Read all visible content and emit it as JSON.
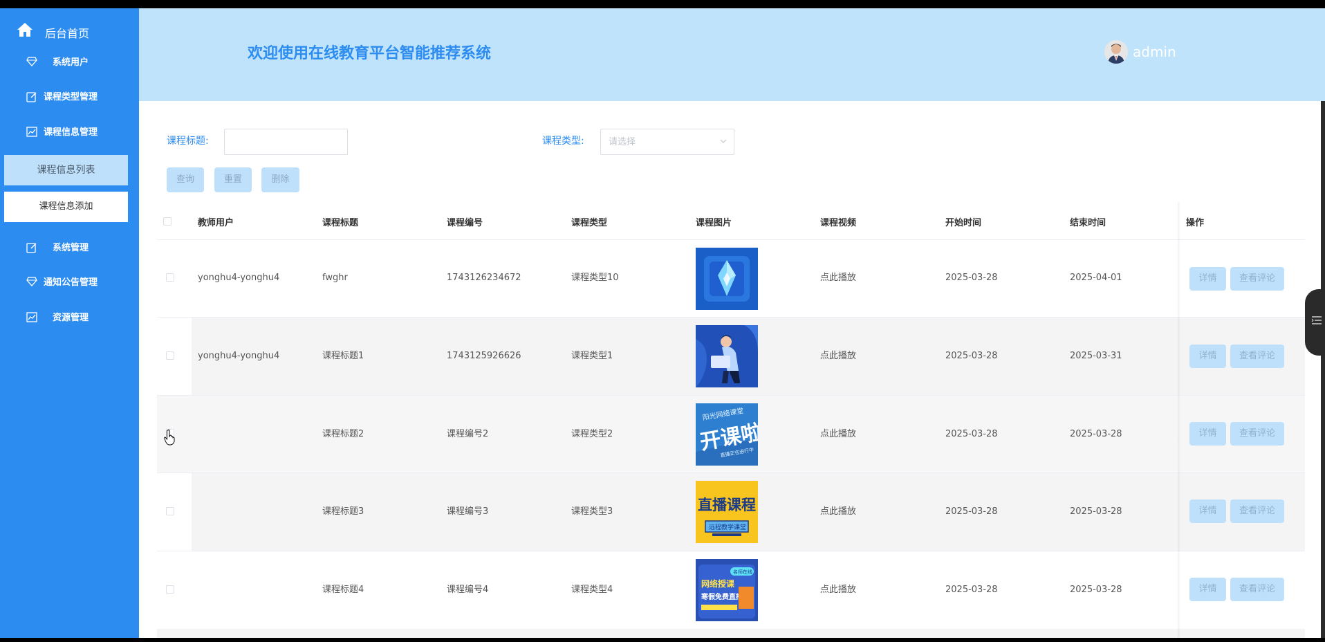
{
  "sidebar": {
    "home": "后台首页",
    "items": [
      {
        "label": "系统用户"
      },
      {
        "label": "课程类型管理"
      },
      {
        "label": "课程信息管理"
      },
      {
        "label": "系统管理"
      },
      {
        "label": "通知公告管理"
      },
      {
        "label": "资源管理"
      }
    ],
    "sub_items": [
      {
        "label": "课程信息列表",
        "active": true
      },
      {
        "label": "课程信息添加",
        "active": false
      }
    ]
  },
  "header": {
    "welcome": "欢迎使用在线教育平台智能推荐系统",
    "username": "admin"
  },
  "search": {
    "title_label": "课程标题:",
    "title_value": "",
    "type_label": "课程类型:",
    "type_placeholder": "请选择"
  },
  "actions": {
    "query": "查询",
    "reset": "重置",
    "delete": "删除"
  },
  "table": {
    "columns": [
      "教师用户",
      "课程标题",
      "课程编号",
      "课程类型",
      "课程图片",
      "课程视频",
      "开始时间",
      "结束时间",
      "操作"
    ],
    "rows": [
      {
        "teacher": "yonghu4-yonghu4",
        "title": "fwghr",
        "code": "1743126234672",
        "type": "课程类型10",
        "image": "blue-crystal",
        "video": "点此播放",
        "start": "2025-03-28",
        "end": "2025-04-01"
      },
      {
        "teacher": "yonghu4-yonghu4",
        "title": "课程标题1",
        "code": "1743125926626",
        "type": "课程类型1",
        "image": "person-laptop",
        "video": "点此播放",
        "start": "2025-03-28",
        "end": "2025-03-31"
      },
      {
        "teacher": "",
        "title": "课程标题2",
        "code": "课程编号2",
        "type": "课程类型2",
        "image": "kaikela-poster",
        "video": "点此播放",
        "start": "2025-03-28",
        "end": "2025-03-28"
      },
      {
        "teacher": "",
        "title": "课程标题3",
        "code": "课程编号3",
        "type": "课程类型3",
        "image": "zhibo-poster",
        "video": "点此播放",
        "start": "2025-03-28",
        "end": "2025-03-28"
      },
      {
        "teacher": "",
        "title": "课程标题4",
        "code": "课程编号4",
        "type": "课程类型4",
        "image": "online-class-poster",
        "video": "点此播放",
        "start": "2025-03-28",
        "end": "2025-03-28"
      }
    ],
    "row_actions": {
      "detail": "详情",
      "comments": "查看评论"
    }
  },
  "thumb_text": {
    "kaikela_top": "阳光网络课堂",
    "kaikela_main": "开课啦",
    "kaikela_sub": "直播正在进行中",
    "zhibo_main": "直播课程",
    "zhibo_sub": "远程教学课堂",
    "online_top": "网络授课",
    "online_mid": "寒假免费直播课",
    "online_badge": "名师在线"
  },
  "colors": {
    "sidebar": "#2d8cf0",
    "header": "#bfe3fb",
    "accent": "#2d8cf0",
    "button": "#bfe0fb"
  }
}
